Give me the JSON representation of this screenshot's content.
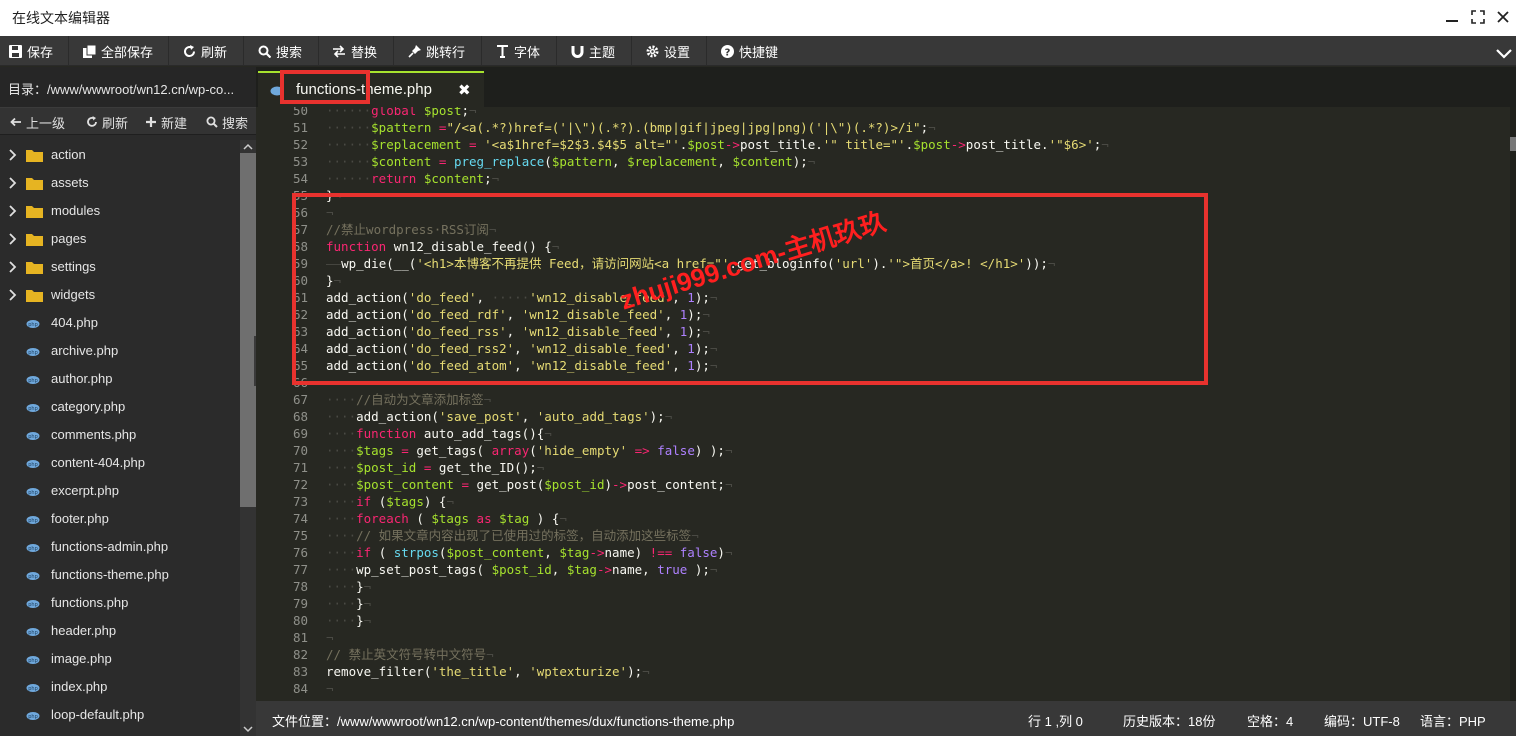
{
  "window": {
    "title": "在线文本编辑器"
  },
  "toolbar": [
    {
      "key": "save",
      "label": "保存",
      "icon": "floppy-icon"
    },
    {
      "key": "saveall",
      "label": "全部保存",
      "icon": "copy-icon"
    },
    {
      "key": "refresh",
      "label": "刷新",
      "icon": "refresh-icon"
    },
    {
      "key": "search",
      "label": "搜索",
      "icon": "search-icon"
    },
    {
      "key": "replace",
      "label": "替换",
      "icon": "swap-icon"
    },
    {
      "key": "goto",
      "label": "跳转行",
      "icon": "pin-icon"
    },
    {
      "key": "font",
      "label": "字体",
      "icon": "text-icon"
    },
    {
      "key": "theme",
      "label": "主题",
      "icon": "magnet-icon"
    },
    {
      "key": "settings",
      "label": "设置",
      "icon": "gear-icon"
    },
    {
      "key": "shortcuts",
      "label": "快捷键",
      "icon": "question-icon"
    }
  ],
  "sidebar": {
    "dir_label": "目录：/www/wwwroot/wn12.cn/wp-co...",
    "actions": [
      {
        "label": "上一级",
        "icon": "back-icon"
      },
      {
        "label": "刷新",
        "icon": "refresh-icon"
      },
      {
        "label": "新建",
        "icon": "plus-icon"
      },
      {
        "label": "搜索",
        "icon": "search-icon"
      }
    ],
    "folders": [
      "action",
      "assets",
      "modules",
      "pages",
      "settings",
      "widgets"
    ],
    "files": [
      "404.php",
      "archive.php",
      "author.php",
      "category.php",
      "comments.php",
      "content-404.php",
      "excerpt.php",
      "footer.php",
      "functions-admin.php",
      "functions-theme.php",
      "functions.php",
      "header.php",
      "image.php",
      "index.php",
      "loop-default.php"
    ]
  },
  "tab": {
    "label": "functions-theme.php",
    "close": "✖"
  },
  "editor": {
    "lines": [
      {
        "n": "50",
        "h": "<span class=\"w\">······</span><span class=\"k\">global</span> <span class=\"v\">$post</span>;<span class=\"w\">¬</span>"
      },
      {
        "n": "51",
        "h": "<span class=\"w\">······</span><span class=\"v\">$pattern</span> <span class=\"k\">=</span><span class=\"s\">\"/&lt;a(.*?)href=('|\\\")(.*?).(bmp|gif|jpeg|jpg|png)('|\\\")(.*?)&gt;/i\"</span>;<span class=\"w\">¬</span>"
      },
      {
        "n": "52",
        "h": "<span class=\"w\">······</span><span class=\"v\">$replacement</span> <span class=\"k\">=</span> <span class=\"s\">'&lt;a$1href=$2$3.$4$5 alt=\"'</span>.<span class=\"v\">$post</span><span class=\"k\">-&gt;</span>post_title.<span class=\"s\">'\" title=\"'</span>.<span class=\"v\">$post</span><span class=\"k\">-&gt;</span>post_title.<span class=\"s\">'\"$6&gt;'</span>;<span class=\"w\">¬</span>"
      },
      {
        "n": "53",
        "h": "<span class=\"w\">······</span><span class=\"v\">$content</span> <span class=\"k\">=</span> <span class=\"f\">preg_replace</span>(<span class=\"v\">$pattern</span>, <span class=\"v\">$replacement</span>, <span class=\"v\">$content</span>);<span class=\"w\">¬</span>"
      },
      {
        "n": "54",
        "h": "<span class=\"w\">······</span><span class=\"k\">return</span> <span class=\"v\">$content</span>;<span class=\"w\">¬</span>"
      },
      {
        "n": "55",
        "h": "}<span class=\"w\">¬</span>"
      },
      {
        "n": "56",
        "h": "<span class=\"w\">¬</span>"
      },
      {
        "n": "57",
        "h": "<span class=\"c\">//禁止wordpress·RSS订阅</span><span class=\"w\">¬</span>"
      },
      {
        "n": "58",
        "h": "<span class=\"k\">function</span> wn12_disable_feed() {<span class=\"w\">¬</span>"
      },
      {
        "n": "59",
        "h": "<span class=\"w\">——</span>wp_die(__(<span class=\"s\">'&lt;h1&gt;本博客不再提供 Feed，请访问网站&lt;a href=\"'</span>.get_bloginfo(<span class=\"s\">'url'</span>).<span class=\"s\">'\"&gt;首页&lt;/a&gt;! &lt;/h1&gt;'</span>));<span class=\"w\">¬</span>"
      },
      {
        "n": "60",
        "h": "}<span class=\"w\">¬</span>"
      },
      {
        "n": "61",
        "h": "add_action(<span class=\"s\">'do_feed'</span>, <span class=\"w\">·····</span><span class=\"s\">'wn12_disable_feed'</span>, <span class=\"n\">1</span>);<span class=\"w\">¬</span>"
      },
      {
        "n": "62",
        "h": "add_action(<span class=\"s\">'do_feed_rdf'</span>, <span class=\"s\">'wn12_disable_feed'</span>, <span class=\"n\">1</span>);<span class=\"w\">¬</span>"
      },
      {
        "n": "63",
        "h": "add_action(<span class=\"s\">'do_feed_rss'</span>, <span class=\"s\">'wn12_disable_feed'</span>, <span class=\"n\">1</span>);<span class=\"w\">¬</span>"
      },
      {
        "n": "64",
        "h": "add_action(<span class=\"s\">'do_feed_rss2'</span>, <span class=\"s\">'wn12_disable_feed'</span>, <span class=\"n\">1</span>);<span class=\"w\">¬</span>"
      },
      {
        "n": "65",
        "h": "add_action(<span class=\"s\">'do_feed_atom'</span>, <span class=\"s\">'wn12_disable_feed'</span>, <span class=\"n\">1</span>);<span class=\"w\">¬</span>"
      },
      {
        "n": "66",
        "h": "<span class=\"w\">¬</span>"
      },
      {
        "n": "67",
        "h": "<span class=\"w\">····</span><span class=\"c\">//自动为文章添加标签</span><span class=\"w\">¬</span>"
      },
      {
        "n": "68",
        "h": "<span class=\"w\">····</span>add_action(<span class=\"s\">'save_post'</span>, <span class=\"s\">'auto_add_tags'</span>);<span class=\"w\">¬</span>"
      },
      {
        "n": "69",
        "h": "<span class=\"w\">····</span><span class=\"k\">function</span> auto_add_tags(){<span class=\"w\">¬</span>"
      },
      {
        "n": "70",
        "h": "<span class=\"w\">····</span><span class=\"v\">$tags</span> <span class=\"k\">=</span> get_tags( <span class=\"k\">array</span>(<span class=\"s\">'hide_empty'</span> <span class=\"k\">=&gt;</span> <span class=\"n\">false</span>) );<span class=\"w\">¬</span>"
      },
      {
        "n": "71",
        "h": "<span class=\"w\">····</span><span class=\"v\">$post_id</span> <span class=\"k\">=</span> get_the_ID();<span class=\"w\">¬</span>"
      },
      {
        "n": "72",
        "h": "<span class=\"w\">····</span><span class=\"v\">$post_content</span> <span class=\"k\">=</span> get_post(<span class=\"v\">$post_id</span>)<span class=\"k\">-&gt;</span>post_content;<span class=\"w\">¬</span>"
      },
      {
        "n": "73",
        "h": "<span class=\"w\">····</span><span class=\"k\">if</span> (<span class=\"v\">$tags</span>) {<span class=\"w\">¬</span>"
      },
      {
        "n": "74",
        "h": "<span class=\"w\">····</span><span class=\"k\">foreach</span> ( <span class=\"v\">$tags</span> <span class=\"k\">as</span> <span class=\"v\">$tag</span> ) {<span class=\"w\">¬</span>"
      },
      {
        "n": "75",
        "h": "<span class=\"w\">····</span><span class=\"c\">// 如果文章内容出现了已使用过的标签，自动添加这些标签</span><span class=\"w\">¬</span>"
      },
      {
        "n": "76",
        "h": "<span class=\"w\">····</span><span class=\"k\">if</span> ( <span class=\"f\">strpos</span>(<span class=\"v\">$post_content</span>, <span class=\"v\">$tag</span><span class=\"k\">-&gt;</span>name) <span class=\"k\">!==</span> <span class=\"n\">false</span>)<span class=\"w\">¬</span>"
      },
      {
        "n": "77",
        "h": "<span class=\"w\">····</span>wp_set_post_tags( <span class=\"v\">$post_id</span>, <span class=\"v\">$tag</span><span class=\"k\">-&gt;</span>name, <span class=\"n\">true</span> );<span class=\"w\">¬</span>"
      },
      {
        "n": "78",
        "h": "<span class=\"w\">····</span>}<span class=\"w\">¬</span>"
      },
      {
        "n": "79",
        "h": "<span class=\"w\">····</span>}<span class=\"w\">¬</span>"
      },
      {
        "n": "80",
        "h": "<span class=\"w\">····</span>}<span class=\"w\">¬</span>"
      },
      {
        "n": "81",
        "h": "<span class=\"w\">¬</span>"
      },
      {
        "n": "82",
        "h": "<span class=\"c\">// 禁止英文符号转中文符号</span><span class=\"w\">¬</span>"
      },
      {
        "n": "83",
        "h": "remove_filter(<span class=\"s\">'the_title'</span>, <span class=\"s\">'wptexturize'</span>);<span class=\"w\">¬</span>"
      },
      {
        "n": "84",
        "h": "<span class=\"w\">¬</span>"
      }
    ]
  },
  "watermark": "zhuji999.com-主机玖玖",
  "status": {
    "path": "文件位置：/www/wwwroot/wn12.cn/wp-content/themes/dux/functions-theme.php",
    "position": "行 1 ,列 0",
    "history": "历史版本：18份",
    "indent": "空格：4",
    "encoding": "编码：UTF-8",
    "language": "语言：PHP"
  },
  "colors": {
    "accent": "#a6e22e",
    "highlight": "#e8322e",
    "folder": "#e6b422",
    "php_icon": "#6fa8dc"
  }
}
